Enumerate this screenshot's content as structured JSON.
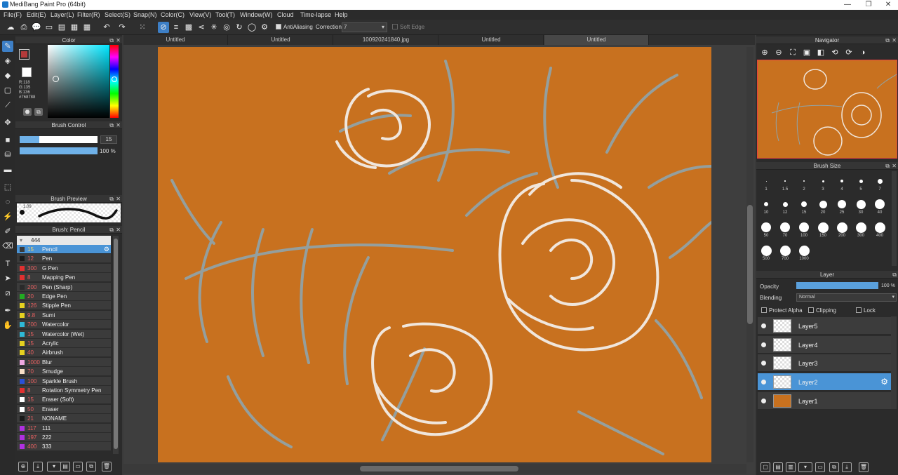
{
  "window": {
    "title": "MediBang Paint Pro (64bit)",
    "minimize": "—",
    "maximize": "❐",
    "close": "✕"
  },
  "menu": [
    "File(F)",
    "Edit(E)",
    "Layer(L)",
    "Filter(R)",
    "Select(S)",
    "Snap(N)",
    "Color(C)",
    "View(V)",
    "Tool(T)",
    "Window(W)",
    "Cloud",
    "Time-lapse",
    "Help"
  ],
  "toolbar": {
    "antialiasing_label": "AntiAliasing",
    "correction_label": "Correction",
    "correction_value": "7",
    "soft_edge_label": "Soft Edge"
  },
  "tabs": [
    "Untitled",
    "Untitled",
    "100920241840.jpg",
    "Untitled",
    "Untitled"
  ],
  "color_panel": {
    "title": "Color",
    "readout": {
      "r": "R:118",
      "g": "G:135",
      "b": "B:136",
      "hex": "#768788"
    },
    "primary_color": "#768788",
    "secondary_color": "#ffffff"
  },
  "brush_control": {
    "title": "Brush Control",
    "size_value": "15",
    "opacity_value": "100 %",
    "size_fraction": 0.25,
    "opacity_fraction": 1.0
  },
  "brush_preview": {
    "title": "Brush Preview",
    "size_label": "1.09"
  },
  "brush_list": {
    "title": "Brush: Pencil",
    "group": "444",
    "items": [
      {
        "size": "15",
        "name": "Pencil",
        "color": "#3a3a3a"
      },
      {
        "size": "12",
        "name": "Pen",
        "color": "#1a1a1a"
      },
      {
        "size": "300",
        "name": "G Pen",
        "color": "#e03030"
      },
      {
        "size": "8",
        "name": "Mapping Pen",
        "color": "#e03030"
      },
      {
        "size": "200",
        "name": "Pen (Sharp)",
        "color": "#2a2a2a"
      },
      {
        "size": "20",
        "name": "Edge Pen",
        "color": "#22aa22"
      },
      {
        "size": "126",
        "name": "Stipple Pen",
        "color": "#e6d020"
      },
      {
        "size": "9.8",
        "name": "Sumi",
        "color": "#e6d020"
      },
      {
        "size": "700",
        "name": "Watercolor",
        "color": "#2fb8d6"
      },
      {
        "size": "15",
        "name": "Watercolor (Wet)",
        "color": "#2fb8d6"
      },
      {
        "size": "15",
        "name": "Acrylic",
        "color": "#e6d020"
      },
      {
        "size": "40",
        "name": "Airbrush",
        "color": "#e6d020"
      },
      {
        "size": "1000",
        "name": "Blur",
        "color": "#f0a8e0"
      },
      {
        "size": "70",
        "name": "Smudge",
        "color": "#f8e0c8"
      },
      {
        "size": "100",
        "name": "Sparkle Brush",
        "color": "#2a50d8"
      },
      {
        "size": "8",
        "name": "Rotation Symmetry Pen",
        "color": "#e03030"
      },
      {
        "size": "15",
        "name": "Eraser (Soft)",
        "color": "#ffffff"
      },
      {
        "size": "50",
        "name": "Eraser",
        "color": "#ffffff"
      },
      {
        "size": "21",
        "name": "NONAME",
        "color": "#1a1a1a"
      },
      {
        "size": "117",
        "name": "111",
        "color": "#b030e0"
      },
      {
        "size": "197",
        "name": "222",
        "color": "#b030e0"
      },
      {
        "size": "400",
        "name": "333",
        "color": "#b030e0"
      }
    ]
  },
  "navigator": {
    "title": "Navigator"
  },
  "brush_size": {
    "title": "Brush Size",
    "sizes": [
      "1",
      "1.5",
      "2",
      "3",
      "4",
      "5",
      "7",
      "10",
      "12",
      "15",
      "20",
      "25",
      "30",
      "40",
      "50",
      "70",
      "100",
      "150",
      "200",
      "300",
      "400",
      "500",
      "700",
      "1000"
    ]
  },
  "layer_panel": {
    "title": "Layer",
    "opacity_label": "Opacity",
    "opacity_value": "100 %",
    "opacity_fraction": 1.0,
    "blending_label": "Blending",
    "blending_value": "Normal",
    "protect_alpha": "Protect Alpha",
    "clipping": "Clipping",
    "lock": "Lock",
    "layers": [
      {
        "name": "Layer5",
        "selected": false
      },
      {
        "name": "Layer4",
        "selected": false
      },
      {
        "name": "Layer3",
        "selected": false
      },
      {
        "name": "Layer2",
        "selected": true
      },
      {
        "name": "Layer1",
        "selected": false,
        "fill": "#c8711f"
      }
    ]
  },
  "colors": {
    "canvas": "#c8711f",
    "accent": "#4a94d6",
    "sketch_light": "#f0e6dc",
    "sketch_gray": "#8fa5ac"
  }
}
